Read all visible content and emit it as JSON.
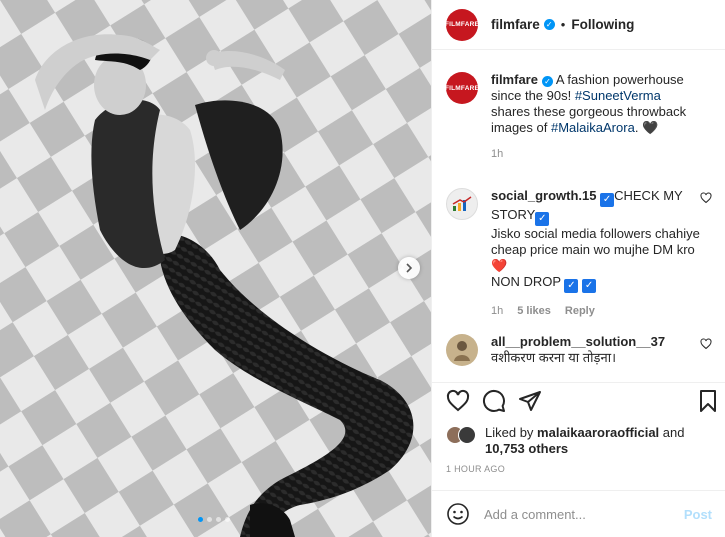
{
  "post": {
    "dots_count": 4,
    "active_dot": 1
  },
  "header": {
    "avatar_text": "FILMFARE",
    "username": "filmfare",
    "separator": "•",
    "follow_state": "Following"
  },
  "caption": {
    "username": "filmfare",
    "text_before": " A fashion powerhouse since the 90s! ",
    "tag1": "#SuneetVerma",
    "text_middle": " shares these gorgeous throwback images of ",
    "tag2": "#MalaikaArora",
    "text_after": ". 🖤",
    "time": "1h"
  },
  "comments": [
    {
      "username": "social_growth.15",
      "line1_after_user": "CHECK MY",
      "line2": "STORY",
      "text": "Jisko social media followers chahiye cheap price main wo mujhe DM kro",
      "heart": "❤️",
      "tail": "NON DROP",
      "time": "1h",
      "likes": "5 likes",
      "reply": "Reply"
    },
    {
      "username": "all__problem__solution__37",
      "text": "वशीकरण करना या तोड़ना।"
    }
  ],
  "liked": {
    "prefix": "Liked by ",
    "user": "malaikaaroraofficial",
    "middle": " and",
    "count": "10,753 others"
  },
  "timestamp": "1 HOUR AGO",
  "add_comment": {
    "placeholder": "Add a comment...",
    "post_label": "Post"
  },
  "colors": {
    "brand": "#c6171f",
    "link": "#00376b",
    "accent": "#0095f6",
    "muted": "#8e8e8e"
  }
}
